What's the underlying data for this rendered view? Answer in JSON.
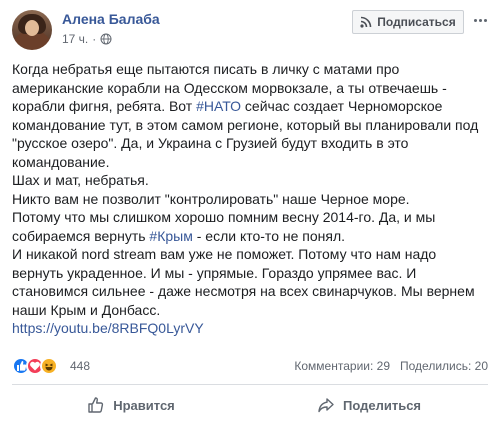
{
  "post": {
    "author": "Алена Балаба",
    "time": "17 ч.",
    "meta_separator": "·",
    "subscribe_label": "Подписаться",
    "paragraphs": [
      [
        "Когда небратья еще пытаются писать в личку с матами про американские корабли на Одесском морвокзале, а ты отвечаешь - корабли фигня, ребята. Вот ",
        "#НАТО",
        " сейчас создает Черноморское командование тут, в этом самом регионе, который вы планировали под \"русское озеро\". Да, и Украина с Грузией будут входить в это командование."
      ],
      [
        "Шах и мат, небратья."
      ],
      [
        "Никто вам не позволит \"контролировать\" наше Черное море."
      ],
      [
        "Потому что мы слишком хорошо помним весну 2014-го. Да, и мы собираемся вернуть ",
        "#Крым",
        " - если кто-то не понял."
      ],
      [
        "И никакой nord stream вам уже не поможет. Потому что нам надо вернуть украденное. И мы - упрямые. Гораздо упрямее вас. И становимся сильнее - даже несмотря на всех свинарчуков. Мы вернем наши Крым и Донбасс."
      ]
    ],
    "link_url": "https://youtu.be/8RBFQ0LyrVY"
  },
  "reactions": {
    "count": "448",
    "icons": [
      "like-icon",
      "love-icon",
      "haha-icon"
    ],
    "comments_label": "Комментарии: 29",
    "shares_label": "Поделились: 20"
  },
  "actions": {
    "like_label": "Нравится",
    "share_label": "Поделиться"
  },
  "colors": {
    "link": "#385898",
    "like": "#1877f2",
    "love": "#f33e58",
    "haha": "#f7b125"
  }
}
